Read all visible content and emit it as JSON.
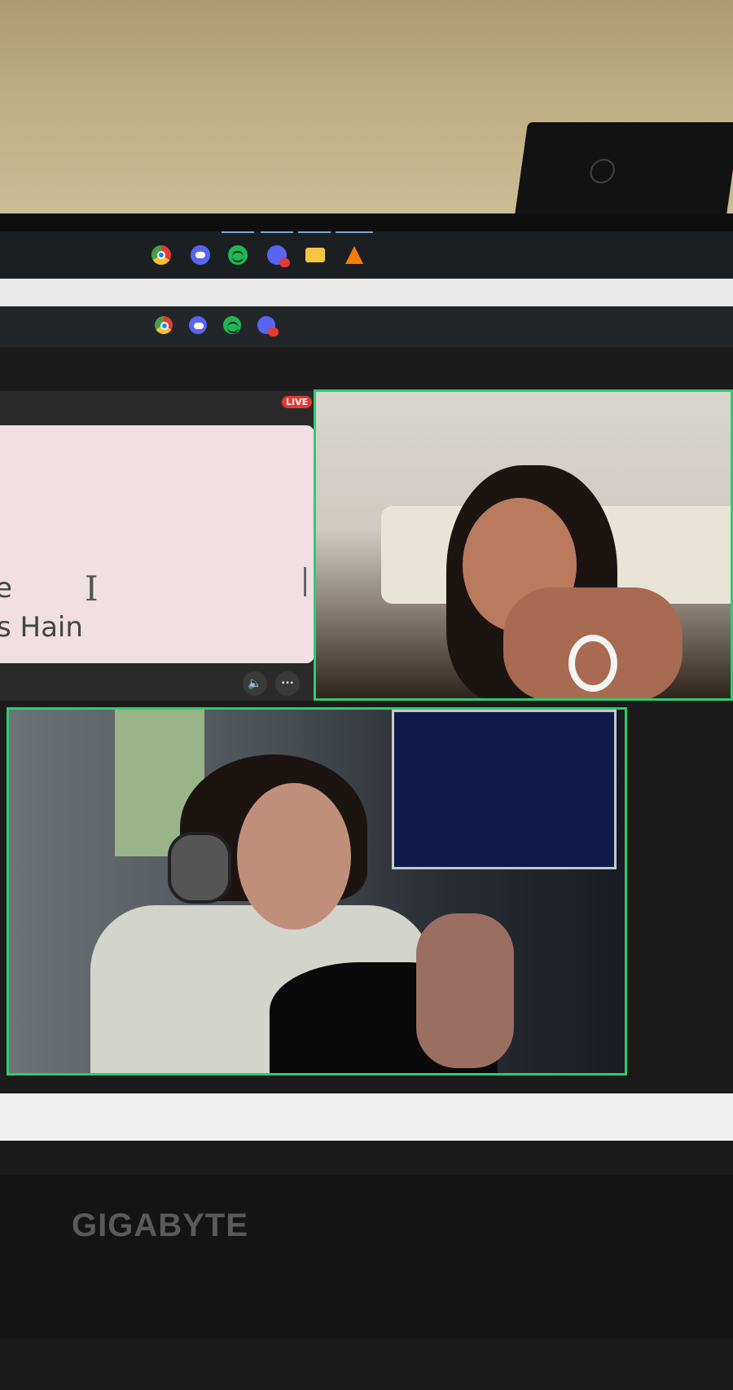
{
  "taskbar_top": {
    "icons": [
      "chrome-icon",
      "discord-icon",
      "spotify-icon",
      "discord-notification-icon",
      "file-explorer-icon",
      "vlc-icon"
    ]
  },
  "taskbar_second": {
    "icons": [
      "chrome-icon",
      "discord-icon",
      "spotify-icon",
      "discord-notification-icon"
    ]
  },
  "share_panel": {
    "live_badge": "LIVE",
    "doc_line1_partial": "e",
    "doc_line2_partial": "s Hain",
    "volume_icon": "speaker-icon",
    "more_label": "•••"
  },
  "monitor": {
    "brand": "GIGABYTE"
  },
  "colors": {
    "active_speaker_border": "#2ecc71",
    "live_badge": "#e53935"
  }
}
